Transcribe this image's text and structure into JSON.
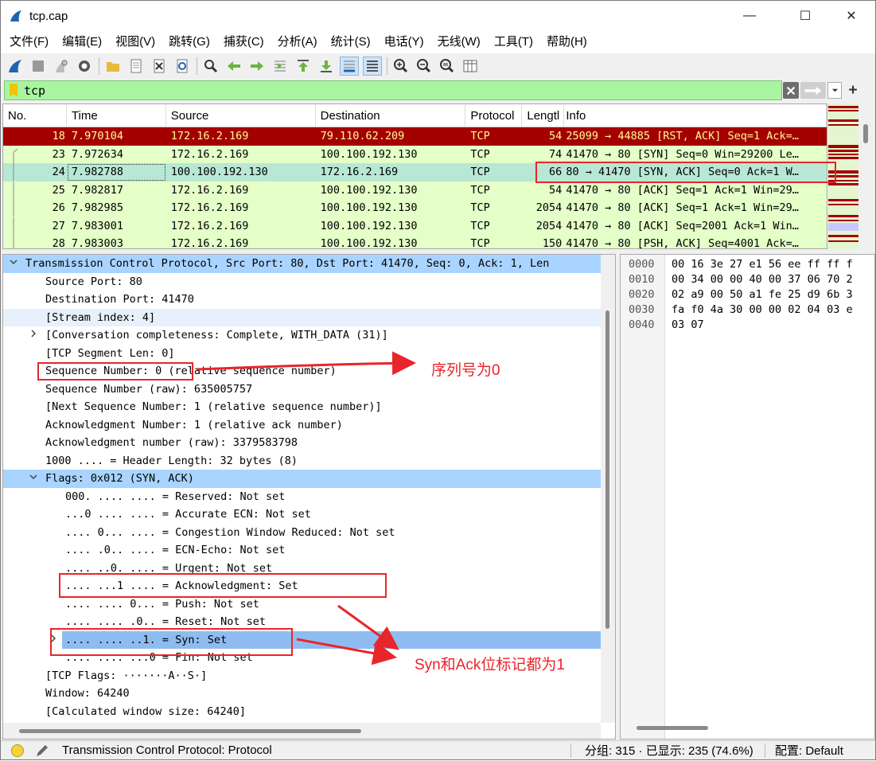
{
  "window": {
    "title": "tcp.cap",
    "minimize": "—",
    "maximize": "☐",
    "close": "✕"
  },
  "menu": [
    "文件(F)",
    "编辑(E)",
    "视图(V)",
    "跳转(G)",
    "捕获(C)",
    "分析(A)",
    "统计(S)",
    "电话(Y)",
    "无线(W)",
    "工具(T)",
    "帮助(H)"
  ],
  "filter": {
    "value": "tcp",
    "add_label": "+"
  },
  "packet_list": {
    "columns": [
      "No.",
      "Time",
      "Source",
      "Destination",
      "Protocol",
      "Lengtl",
      "Info"
    ],
    "rows": [
      {
        "no": "18",
        "time": "7.970104",
        "src": "172.16.2.169",
        "dst": "79.110.62.209",
        "proto": "TCP",
        "len": "54",
        "info": "25099 → 44885 [RST, ACK] Seq=1 Ack=…",
        "style": "rst"
      },
      {
        "no": "23",
        "time": "7.972634",
        "src": "172.16.2.169",
        "dst": "100.100.192.130",
        "proto": "TCP",
        "len": "74",
        "info": "41470 → 80 [SYN] Seq=0 Win=29200 Le…",
        "style": "normal"
      },
      {
        "no": "24",
        "time": "7.982788",
        "src": "100.100.192.130",
        "dst": "172.16.2.169",
        "proto": "TCP",
        "len": "66",
        "info": "80 → 41470 [SYN, ACK] Seq=0 Ack=1 W…",
        "style": "selected"
      },
      {
        "no": "25",
        "time": "7.982817",
        "src": "172.16.2.169",
        "dst": "100.100.192.130",
        "proto": "TCP",
        "len": "54",
        "info": "41470 → 80 [ACK] Seq=1 Ack=1 Win=29…",
        "style": "normal"
      },
      {
        "no": "26",
        "time": "7.982985",
        "src": "172.16.2.169",
        "dst": "100.100.192.130",
        "proto": "TCP",
        "len": "2054",
        "info": "41470 → 80 [ACK] Seq=1 Ack=1 Win=29…",
        "style": "normal"
      },
      {
        "no": "27",
        "time": "7.983001",
        "src": "172.16.2.169",
        "dst": "100.100.192.130",
        "proto": "TCP",
        "len": "2054",
        "info": "41470 → 80 [ACK] Seq=2001 Ack=1 Win…",
        "style": "normal"
      },
      {
        "no": "28",
        "time": "7.983003",
        "src": "172.16.2.169",
        "dst": "100.100.192.130",
        "proto": "TCP",
        "len": "150",
        "info": "41470 → 80 [PSH, ACK] Seq=4001 Ack=…",
        "style": "normal"
      }
    ]
  },
  "details": [
    {
      "text": "Transmission Control Protocol, Src Port: 80, Dst Port: 41470, Seq: 0, Ack: 1, Len",
      "indent": 0,
      "arrow": "v",
      "style": "top"
    },
    {
      "text": "Source Port: 80",
      "indent": 1,
      "arrow": "",
      "style": ""
    },
    {
      "text": "Destination Port: 41470",
      "indent": 1,
      "arrow": "",
      "style": ""
    },
    {
      "text": "[Stream index: 4]",
      "indent": 1,
      "arrow": "",
      "style": "lhl"
    },
    {
      "text": "[Conversation completeness: Complete, WITH_DATA (31)]",
      "indent": 1,
      "arrow": ">",
      "style": ""
    },
    {
      "text": "[TCP Segment Len: 0]",
      "indent": 1,
      "arrow": "",
      "style": ""
    },
    {
      "text": "Sequence Number: 0    (relative sequence number)",
      "indent": 1,
      "arrow": "",
      "style": ""
    },
    {
      "text": "Sequence Number (raw): 635005757",
      "indent": 1,
      "arrow": "",
      "style": ""
    },
    {
      "text": "[Next Sequence Number: 1    (relative sequence number)]",
      "indent": 1,
      "arrow": "",
      "style": ""
    },
    {
      "text": "Acknowledgment Number: 1    (relative ack number)",
      "indent": 1,
      "arrow": "",
      "style": ""
    },
    {
      "text": "Acknowledgment number (raw): 3379583798",
      "indent": 1,
      "arrow": "",
      "style": ""
    },
    {
      "text": "1000 .... = Header Length: 32 bytes (8)",
      "indent": 1,
      "arrow": "",
      "style": ""
    },
    {
      "text": "Flags: 0x012 (SYN, ACK)",
      "indent": 1,
      "arrow": "v",
      "style": "hl"
    },
    {
      "text": "000. .... .... = Reserved: Not set",
      "indent": 2,
      "arrow": "",
      "style": ""
    },
    {
      "text": "...0 .... .... = Accurate ECN: Not set",
      "indent": 2,
      "arrow": "",
      "style": ""
    },
    {
      "text": ".... 0... .... = Congestion Window Reduced: Not set",
      "indent": 2,
      "arrow": "",
      "style": ""
    },
    {
      "text": ".... .0.. .... = ECN-Echo: Not set",
      "indent": 2,
      "arrow": "",
      "style": ""
    },
    {
      "text": ".... ..0. .... = Urgent: Not set",
      "indent": 2,
      "arrow": "",
      "style": ""
    },
    {
      "text": ".... ...1 .... = Acknowledgment: Set",
      "indent": 2,
      "arrow": "",
      "style": ""
    },
    {
      "text": ".... .... 0... = Push: Not set",
      "indent": 2,
      "arrow": "",
      "style": ""
    },
    {
      "text": ".... .... .0.. = Reset: Not set",
      "indent": 2,
      "arrow": "",
      "style": ""
    },
    {
      "text": ".... .... ..1. = Syn: Set",
      "indent": 2,
      "arrow": ">",
      "style": "sel"
    },
    {
      "text": ".... .... ...0 = Fin: Not set",
      "indent": 2,
      "arrow": "",
      "style": ""
    },
    {
      "text": "[TCP Flags: ·······A··S·]",
      "indent": 1,
      "arrow": "",
      "style": ""
    },
    {
      "text": "Window: 64240",
      "indent": 1,
      "arrow": "",
      "style": ""
    },
    {
      "text": "[Calculated window size: 64240]",
      "indent": 1,
      "arrow": "",
      "style": ""
    }
  ],
  "bytes": {
    "offsets": [
      "0000",
      "0010",
      "0020",
      "0030",
      "0040"
    ],
    "hex": [
      "00 16 3e 27 e1 56 ee ff  ff f",
      "00 34 00 00 40 00 37 06  70 2",
      "02 a9 00 50 a1 fe 25 d9  6b 3",
      "fa f0 4a 30 00 00 02 04  03 e",
      "03 07"
    ]
  },
  "status": {
    "text": "Transmission Control Protocol: Protocol",
    "packets": "分组: 315 · 已显示: 235 (74.6%)",
    "profile": "配置:  Default"
  },
  "annotations": {
    "seq_label": "序列号为0",
    "flags_label": "Syn和Ack位标记都为1"
  },
  "colors": {
    "rst_bg": "#a40000",
    "rst_fg": "#fffc9c",
    "normal_bg": "#e4ffc7",
    "selected_bg": "#b8e8d4",
    "annotation": "#e8252b",
    "filter_bg": "#a8f5a0"
  }
}
